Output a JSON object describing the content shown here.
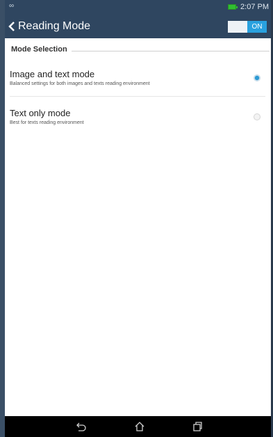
{
  "status_bar": {
    "left_icon": "∞",
    "time": "2:07 PM",
    "battery_icon": "battery-charging-icon",
    "battery_color": "#30c030"
  },
  "action_bar": {
    "back_icon": "back-chevron-icon",
    "title": "Reading Mode",
    "toggle_label": "ON",
    "accent": "#29a1df",
    "background": "#2f4660"
  },
  "section": {
    "title": "Mode Selection"
  },
  "options": [
    {
      "title": "Image and text mode",
      "subtitle": "Balanced settings for both images and texts reading environment",
      "selected": true
    },
    {
      "title": "Text only mode",
      "subtitle": "Best for texts reading environment",
      "selected": false
    }
  ],
  "nav_bar": {
    "icons": [
      "back-icon",
      "home-icon",
      "recent-apps-icon"
    ]
  }
}
